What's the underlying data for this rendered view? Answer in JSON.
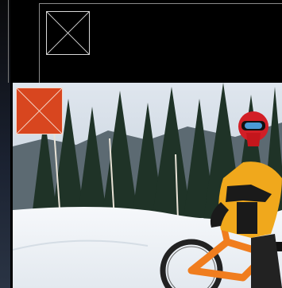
{
  "placeholders": {
    "top_icon": "broken-image-icon",
    "badge_icon": "broken-image-icon",
    "badge_color": "#d8461f"
  },
  "photo": {
    "subject": "downhill-bike-rider-in-snow",
    "sky_color": "#c9d3dd",
    "snow_color": "#f3f6f9",
    "jersey_color": "#f0a81c",
    "bike_color": "#f07d1e"
  }
}
